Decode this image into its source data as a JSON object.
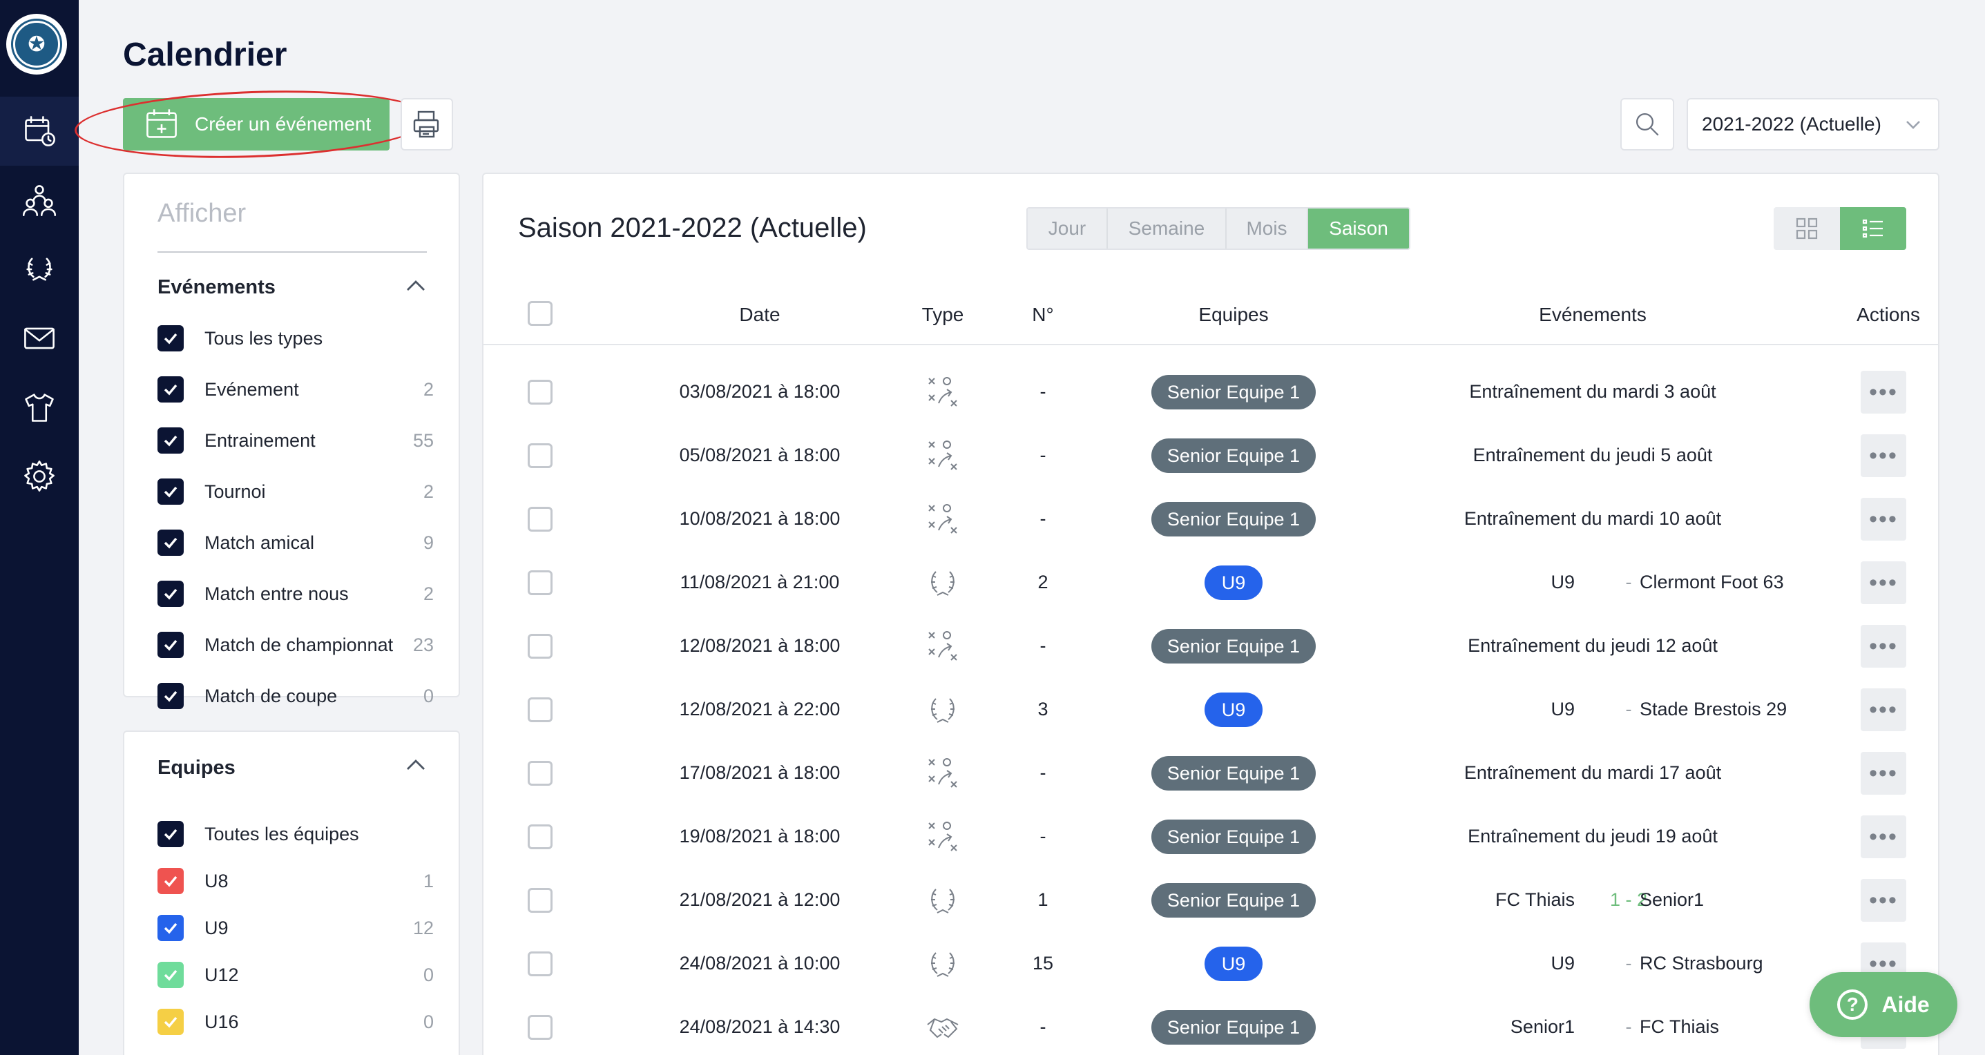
{
  "sidebar": {
    "logo_alt": "club-logo",
    "items": [
      {
        "icon": "calendar-icon",
        "active": true
      },
      {
        "icon": "users-icon",
        "active": false
      },
      {
        "icon": "trophy-icon",
        "active": false
      },
      {
        "icon": "mail-icon",
        "active": false
      },
      {
        "icon": "shirt-icon",
        "active": false
      },
      {
        "icon": "gear-icon",
        "active": false
      }
    ]
  },
  "header": {
    "title": "Calendrier",
    "create_label": "Créer un événement",
    "season_value": "2021-2022 (Actuelle)"
  },
  "filters": {
    "afficher_placeholder": "Afficher",
    "events_title": "Evénements",
    "events": [
      {
        "label": "Tous les types",
        "count": ""
      },
      {
        "label": "Evénement",
        "count": "2"
      },
      {
        "label": "Entrainement",
        "count": "55"
      },
      {
        "label": "Tournoi",
        "count": "2"
      },
      {
        "label": "Match amical",
        "count": "9"
      },
      {
        "label": "Match entre nous",
        "count": "2"
      },
      {
        "label": "Match de championnat",
        "count": "23"
      },
      {
        "label": "Match de coupe",
        "count": "0"
      }
    ],
    "teams_title": "Equipes",
    "teams": [
      {
        "label": "Toutes les équipes",
        "count": "",
        "color": "#0b1433"
      },
      {
        "label": "U8",
        "count": "1",
        "color": "#ef5350"
      },
      {
        "label": "U9",
        "count": "12",
        "color": "#2563eb"
      },
      {
        "label": "U12",
        "count": "0",
        "color": "#6fdc9b"
      },
      {
        "label": "U16",
        "count": "0",
        "color": "#f5cf45"
      }
    ]
  },
  "main": {
    "title": "Saison 2021-2022 (Actuelle)",
    "view_tabs": [
      "Jour",
      "Semaine",
      "Mois",
      "Saison"
    ],
    "active_tab": "Saison",
    "columns": [
      "Date",
      "Type",
      "N°",
      "Equipes",
      "Evénements",
      "Actions"
    ],
    "rows": [
      {
        "date": "03/08/2021 à 18:00",
        "type": "training",
        "num": "-",
        "team": "Senior Equipe 1",
        "team_kind": "senior",
        "event": "Entraînement du mardi 3 août"
      },
      {
        "date": "05/08/2021 à 18:00",
        "type": "training",
        "num": "-",
        "team": "Senior Equipe 1",
        "team_kind": "senior",
        "event": "Entraînement du jeudi 5 août"
      },
      {
        "date": "10/08/2021 à 18:00",
        "type": "training",
        "num": "-",
        "team": "Senior Equipe 1",
        "team_kind": "senior",
        "event": "Entraînement du mardi 10 août"
      },
      {
        "date": "11/08/2021 à 21:00",
        "type": "match",
        "num": "2",
        "team": "U9",
        "team_kind": "u9",
        "home": "U9",
        "score": "-",
        "away": "Clermont Foot 63"
      },
      {
        "date": "12/08/2021 à 18:00",
        "type": "training",
        "num": "-",
        "team": "Senior Equipe 1",
        "team_kind": "senior",
        "event": "Entraînement du jeudi 12 août"
      },
      {
        "date": "12/08/2021 à 22:00",
        "type": "match",
        "num": "3",
        "team": "U9",
        "team_kind": "u9",
        "home": "U9",
        "score": "-",
        "away": "Stade Brestois 29"
      },
      {
        "date": "17/08/2021 à 18:00",
        "type": "training",
        "num": "-",
        "team": "Senior Equipe 1",
        "team_kind": "senior",
        "event": "Entraînement du mardi 17 août"
      },
      {
        "date": "19/08/2021 à 18:00",
        "type": "training",
        "num": "-",
        "team": "Senior Equipe 1",
        "team_kind": "senior",
        "event": "Entraînement du jeudi 19 août"
      },
      {
        "date": "21/08/2021 à 12:00",
        "type": "match",
        "num": "1",
        "team": "Senior Equipe 1",
        "team_kind": "senior",
        "home": "FC Thiais",
        "score": "1 - 2",
        "away": "Senior1"
      },
      {
        "date": "24/08/2021 à 10:00",
        "type": "match",
        "num": "15",
        "team": "U9",
        "team_kind": "u9",
        "home": "U9",
        "score": "-",
        "away": "RC Strasbourg"
      },
      {
        "date": "24/08/2021 à 14:30",
        "type": "friendly",
        "num": "-",
        "team": "Senior Equipe 1",
        "team_kind": "senior",
        "home": "Senior1",
        "score": "-",
        "away": "FC Thiais"
      }
    ]
  },
  "help": {
    "label": "Aide"
  },
  "colors": {
    "accent": "#6ebd7c",
    "sidebar": "#0b1433",
    "u9": "#2563eb",
    "senior": "#5f6f7a",
    "annotation": "#dc2f2f"
  }
}
